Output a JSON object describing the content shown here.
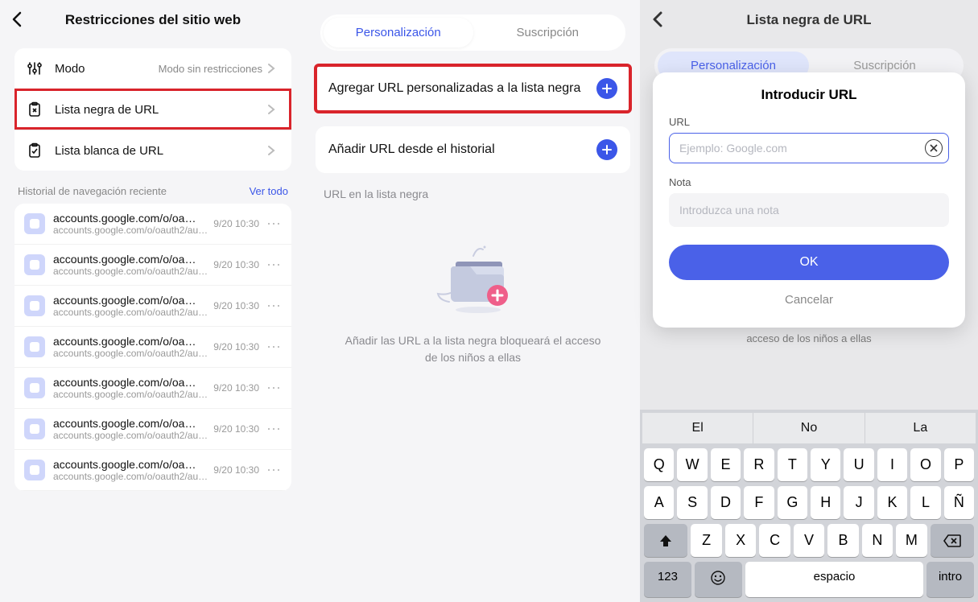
{
  "panel1": {
    "title": "Restricciones del sitio web",
    "rows": {
      "mode": {
        "label": "Modo",
        "value": "Modo sin restricciones"
      },
      "blacklist": {
        "label": "Lista negra de URL"
      },
      "whitelist": {
        "label": "Lista blanca de URL"
      }
    },
    "history_section": {
      "title": "Historial de navegación reciente",
      "see_all": "Ver todo"
    },
    "history": [
      {
        "title": "accounts.google.com/o/oa…",
        "sub": "accounts.google.com/o/oauth2/auth?red…",
        "time": "9/20 10:30"
      },
      {
        "title": "accounts.google.com/o/oa…",
        "sub": "accounts.google.com/o/oauth2/auth?red…",
        "time": "9/20 10:30"
      },
      {
        "title": "accounts.google.com/o/oa…",
        "sub": "accounts.google.com/o/oauth2/auth?red…",
        "time": "9/20 10:30"
      },
      {
        "title": "accounts.google.com/o/oa…",
        "sub": "accounts.google.com/o/oauth2/auth?red…",
        "time": "9/20 10:30"
      },
      {
        "title": "accounts.google.com/o/oa…",
        "sub": "accounts.google.com/o/oauth2/auth?red…",
        "time": "9/20 10:30"
      },
      {
        "title": "accounts.google.com/o/oa…",
        "sub": "accounts.google.com/o/oauth2/auth?red…",
        "time": "9/20 10:30"
      },
      {
        "title": "accounts.google.com/o/oa…",
        "sub": "accounts.google.com/o/oauth2/auth?red…",
        "time": "9/20 10:30"
      }
    ]
  },
  "panel2": {
    "tabs": {
      "personalization": "Personalización",
      "subscription": "Suscripción"
    },
    "add_custom": "Agregar URL personalizadas a la lista negra",
    "add_history": "Añadir URL desde el historial",
    "list_header": "URL en la lista negra",
    "empty_msg": "Añadir las URL a la lista negra bloqueará el acceso de los niños a ellas"
  },
  "panel3": {
    "title": "Lista negra de URL",
    "tabs": {
      "personalization": "Personalización",
      "subscription": "Suscripción"
    },
    "dialog": {
      "title": "Introducir URL",
      "url_label": "URL",
      "url_placeholder": "Ejemplo: Google.com",
      "note_label": "Nota",
      "note_placeholder": "Introduzca una nota",
      "ok": "OK",
      "cancel": "Cancelar"
    },
    "under_text": "acceso de los niños a ellas",
    "keyboard": {
      "suggest": [
        "El",
        "No",
        "La"
      ],
      "row1": [
        "Q",
        "W",
        "E",
        "R",
        "T",
        "Y",
        "U",
        "I",
        "O",
        "P"
      ],
      "row2": [
        "A",
        "S",
        "D",
        "F",
        "G",
        "H",
        "J",
        "K",
        "L",
        "Ñ"
      ],
      "row3": [
        "Z",
        "X",
        "C",
        "V",
        "B",
        "N",
        "M"
      ],
      "num": "123",
      "space": "espacio",
      "enter": "intro"
    }
  }
}
